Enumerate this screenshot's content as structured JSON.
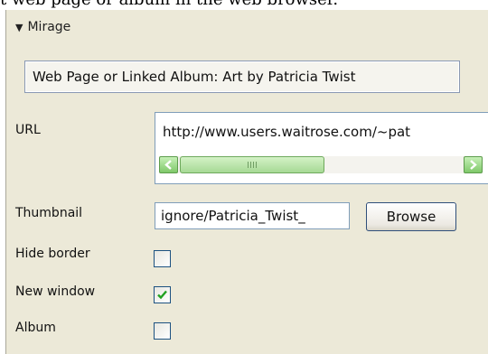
{
  "caption": "t web page or album in the web browser.",
  "section": {
    "title": "Mirage",
    "expanded_icon": "triangle-down-icon"
  },
  "album_button_label": "Web Page or Linked Album: Art by Patricia Twist",
  "fields": {
    "url_label": "URL",
    "url_value": "http://www.users.waitrose.com/~pat",
    "thumbnail_label": "Thumbnail",
    "thumbnail_value": "ignore/Patricia_Twist_",
    "browse_label": "Browse",
    "hide_border_label": "Hide border",
    "hide_border_checked": false,
    "new_window_label": "New window",
    "new_window_checked": true,
    "album_label": "Album",
    "album_checked": false
  },
  "scrollbar": {
    "left_icon": "arrow-left-icon",
    "right_icon": "arrow-right-icon",
    "grip_icon": "grip-icon"
  },
  "colors": {
    "panel_bg": "#ece9d8",
    "scroll_green": "#7fc86a",
    "check_green": "#21a121",
    "input_border": "#7f9db9"
  }
}
